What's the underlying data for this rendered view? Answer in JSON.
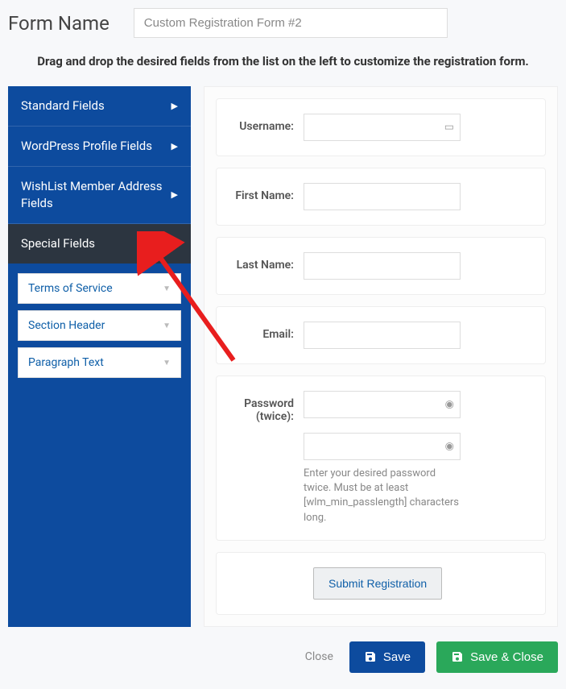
{
  "header": {
    "label": "Form Name",
    "value": "Custom Registration Form #2"
  },
  "instruction": "Drag and drop the desired fields from the list on the left to customize the registration form.",
  "sidebar": {
    "sections": [
      {
        "label": "Standard Fields",
        "expanded": false
      },
      {
        "label": "WordPress Profile Fields",
        "expanded": false
      },
      {
        "label": "WishList Member Address Fields",
        "expanded": false
      },
      {
        "label": "Special Fields",
        "expanded": true
      }
    ],
    "special_fields": [
      {
        "label": "Terms of Service"
      },
      {
        "label": "Section Header"
      },
      {
        "label": "Paragraph Text"
      }
    ]
  },
  "form": {
    "rows": [
      {
        "label": "Username:",
        "icon": "contact"
      },
      {
        "label": "First Name:"
      },
      {
        "label": "Last Name:"
      },
      {
        "label": "Email:"
      },
      {
        "label": "Password (twice):",
        "icon": "key",
        "double": true,
        "help": "Enter your desired password twice. Must be at least [wlm_min_passlength] characters long."
      }
    ],
    "submit_label": "Submit Registration"
  },
  "footer": {
    "close": "Close",
    "save": "Save",
    "save_close": "Save & Close"
  }
}
